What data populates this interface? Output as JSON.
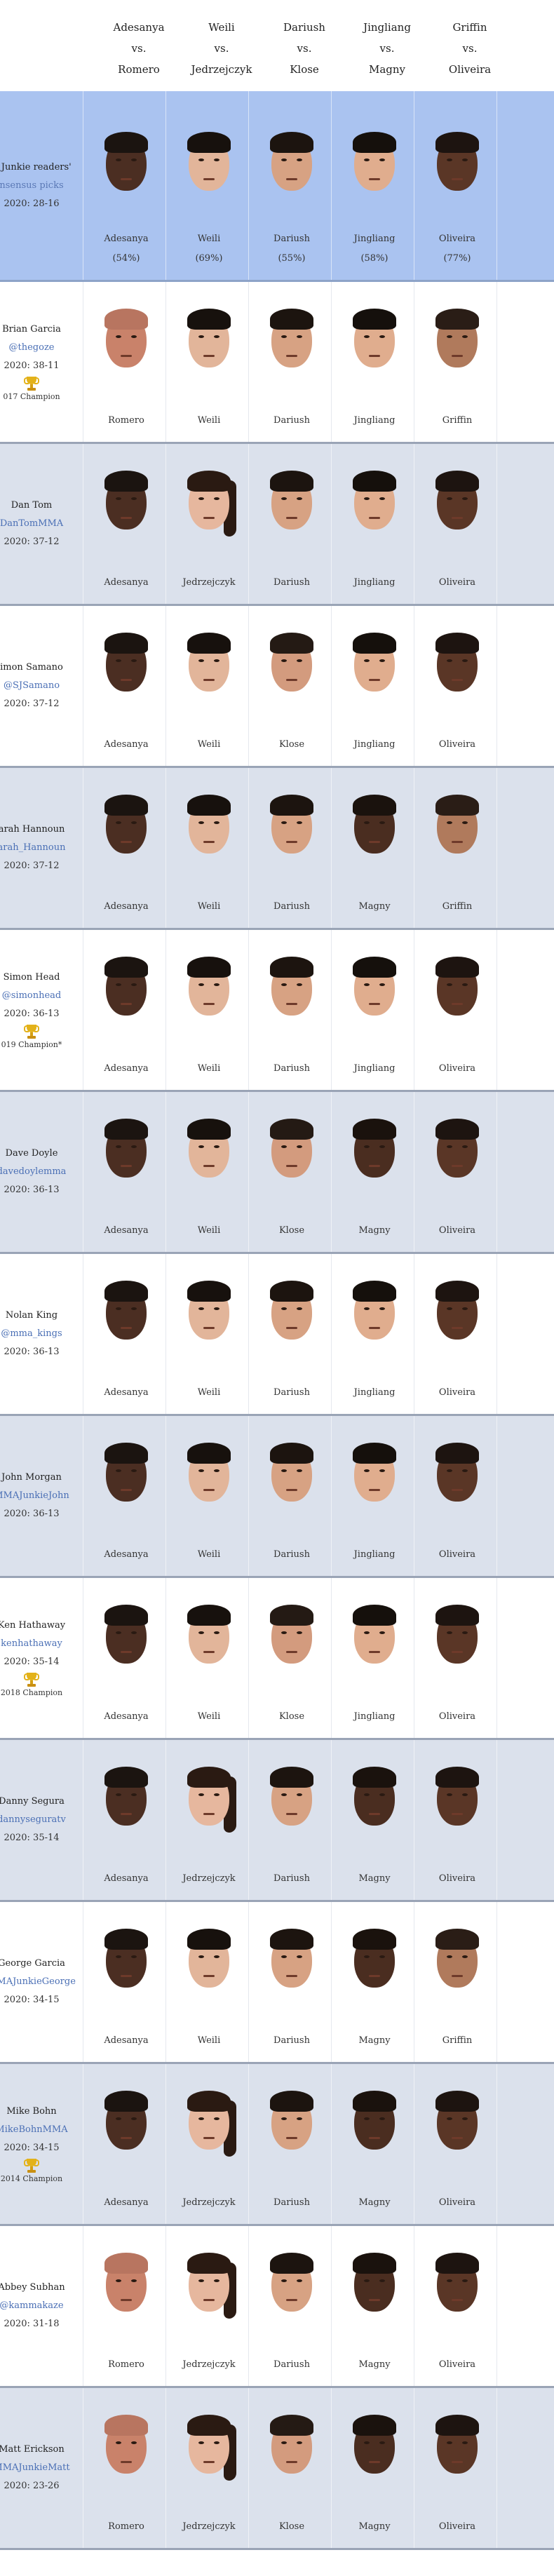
{
  "fights": [
    {
      "a": "Adesanya",
      "vs": "vs.",
      "b": "Romero"
    },
    {
      "a": "Weili",
      "vs": "vs.",
      "b": "Jedrzejczyk"
    },
    {
      "a": "Dariush",
      "vs": "vs.",
      "b": "Klose"
    },
    {
      "a": "Jingliang",
      "vs": "vs.",
      "b": "Magny"
    },
    {
      "a": "Griffin",
      "vs": "vs.",
      "b": "Oliveira"
    }
  ],
  "readers": {
    "name": "A Junkie readers'",
    "handle": "nsensus picks",
    "record": "2020: 28-16",
    "picks": [
      "Adesanya",
      "Weili",
      "Dariush",
      "Jingliang",
      "Oliveira"
    ],
    "percents": [
      "(54%)",
      "(69%)",
      "(55%)",
      "(58%)",
      "(77%)"
    ]
  },
  "analysts": [
    {
      "name": "Brian Garcia",
      "handle": "@thegoze",
      "record": "2020: 38-11",
      "champ": "017 Champion",
      "picks": [
        "Romero",
        "Weili",
        "Dariush",
        "Jingliang",
        "Griffin"
      ]
    },
    {
      "name": "Dan Tom",
      "handle": "DanTomMMA",
      "record": "2020: 37-12",
      "champ": "",
      "picks": [
        "Adesanya",
        "Jedrzejczyk",
        "Dariush",
        "Jingliang",
        "Oliveira"
      ]
    },
    {
      "name": "imon Samano",
      "handle": "@SJSamano",
      "record": "2020: 37-12",
      "champ": "",
      "picks": [
        "Adesanya",
        "Weili",
        "Klose",
        "Jingliang",
        "Oliveira"
      ]
    },
    {
      "name": "arah Hannoun",
      "handle": "arah_Hannoun",
      "record": "2020: 37-12",
      "champ": "",
      "picks": [
        "Adesanya",
        "Weili",
        "Dariush",
        "Magny",
        "Griffin"
      ]
    },
    {
      "name": "Simon Head",
      "handle": "@simonhead",
      "record": "2020: 36-13",
      "champ": "019 Champion*",
      "picks": [
        "Adesanya",
        "Weili",
        "Dariush",
        "Jingliang",
        "Oliveira"
      ]
    },
    {
      "name": "Dave Doyle",
      "handle": "davedoylemma",
      "record": "2020: 36-13",
      "champ": "",
      "picks": [
        "Adesanya",
        "Weili",
        "Klose",
        "Magny",
        "Oliveira"
      ]
    },
    {
      "name": "Nolan King",
      "handle": "@mma_kings",
      "record": "2020: 36-13",
      "champ": "",
      "picks": [
        "Adesanya",
        "Weili",
        "Dariush",
        "Jingliang",
        "Oliveira"
      ]
    },
    {
      "name": "John Morgan",
      "handle": "MMAJunkieJohn",
      "record": "2020: 36-13",
      "champ": "",
      "picks": [
        "Adesanya",
        "Weili",
        "Dariush",
        "Jingliang",
        "Oliveira"
      ]
    },
    {
      "name": "Ken Hathaway",
      "handle": "kenhathaway",
      "record": "2020: 35-14",
      "champ": "2018 Champion",
      "picks": [
        "Adesanya",
        "Weili",
        "Klose",
        "Jingliang",
        "Oliveira"
      ]
    },
    {
      "name": "Danny Segura",
      "handle": "dannyseguratv",
      "record": "2020: 35-14",
      "champ": "",
      "picks": [
        "Adesanya",
        "Jedrzejczyk",
        "Dariush",
        "Magny",
        "Oliveira"
      ]
    },
    {
      "name": "George Garcia",
      "handle": "MMAJunkieGeorge",
      "record": "2020: 34-15",
      "champ": "",
      "picks": [
        "Adesanya",
        "Weili",
        "Dariush",
        "Magny",
        "Griffin"
      ]
    },
    {
      "name": "Mike Bohn",
      "handle": "MikeBohnMMA",
      "record": "2020: 34-15",
      "champ": "2014 Champion",
      "picks": [
        "Adesanya",
        "Jedrzejczyk",
        "Dariush",
        "Magny",
        "Oliveira"
      ]
    },
    {
      "name": "Abbey Subhan",
      "handle": "@kammakaze",
      "record": "2020: 31-18",
      "champ": "",
      "picks": [
        "Romero",
        "Jedrzejczyk",
        "Dariush",
        "Magny",
        "Oliveira"
      ]
    },
    {
      "name": "Matt Erickson",
      "handle": "MMAJunkieMatt",
      "record": "2020: 23-26",
      "champ": "",
      "picks": [
        "Romero",
        "Jedrzejczyk",
        "Klose",
        "Magny",
        "Oliveira"
      ]
    }
  ],
  "fighter_styles": {
    "Adesanya": {
      "skin": "#4b2e22",
      "hair": "#1b1410",
      "ponytail": false
    },
    "Romero": {
      "skin": "#c9826a",
      "hair": "#b87560",
      "ponytail": false
    },
    "Weili": {
      "skin": "#e2b59a",
      "hair": "#17110d",
      "ponytail": false
    },
    "Jedrzejczyk": {
      "skin": "#e6b79e",
      "hair": "#2a1a12",
      "ponytail": true
    },
    "Dariush": {
      "skin": "#d7a283",
      "hair": "#1c140f",
      "ponytail": false
    },
    "Klose": {
      "skin": "#d39b7e",
      "hair": "#241a14",
      "ponytail": false
    },
    "Jingliang": {
      "skin": "#e0ad8e",
      "hair": "#15100c",
      "ponytail": false
    },
    "Magny": {
      "skin": "#4a2d20",
      "hair": "#1a120d",
      "ponytail": false
    },
    "Griffin": {
      "skin": "#b07a5c",
      "hair": "#2a1d16",
      "ponytail": false
    },
    "Oliveira": {
      "skin": "#5a3626",
      "hair": "#1d1410",
      "ponytail": false
    }
  }
}
